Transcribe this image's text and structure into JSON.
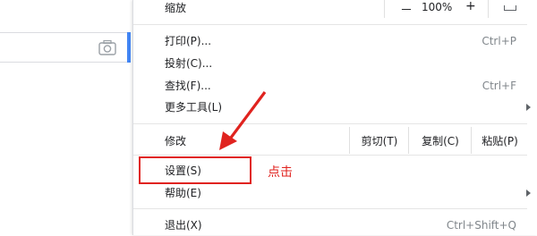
{
  "search": {
    "camera_icon": "camera-icon",
    "accent_color": "#4285f4"
  },
  "menu": {
    "zoom": {
      "label": "缩放",
      "minus": "－",
      "value": "100%",
      "plus": "+",
      "fullscreen_icon": "fullscreen-icon"
    },
    "print": {
      "label": "打印(P)...",
      "shortcut": "Ctrl+P"
    },
    "cast": {
      "label": "投射(C)..."
    },
    "find": {
      "label": "查找(F)...",
      "shortcut": "Ctrl+F"
    },
    "more_tools": {
      "label": "更多工具(L)"
    },
    "edit": {
      "label": "修改",
      "cut": "剪切(T)",
      "copy": "复制(C)",
      "paste": "粘贴(P)"
    },
    "settings": {
      "label": "设置(S)"
    },
    "help": {
      "label": "帮助(E)"
    },
    "exit": {
      "label": "退出(X)",
      "shortcut": "Ctrl+Shift+Q"
    }
  },
  "annotation": {
    "text": "点击",
    "color": "#e0231f"
  }
}
